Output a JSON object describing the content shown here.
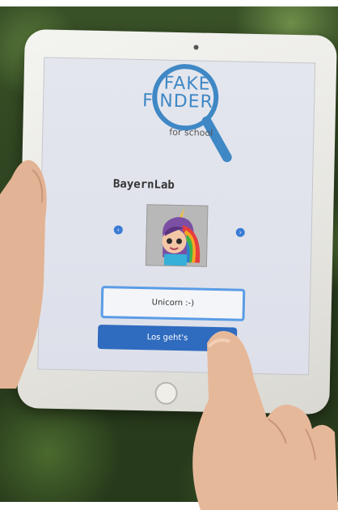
{
  "app": {
    "logo_line1": "FAKE",
    "logo_line2": "FINDER",
    "logo_subtitle": "for school"
  },
  "profile": {
    "username": "BayernLab",
    "avatar_icon": "unicorn-avatar-icon"
  },
  "form": {
    "name_value": "Unicorn :-)",
    "submit_label": "Los geht's"
  },
  "colors": {
    "accent": "#3f88c5",
    "button": "#2f6bbf"
  }
}
